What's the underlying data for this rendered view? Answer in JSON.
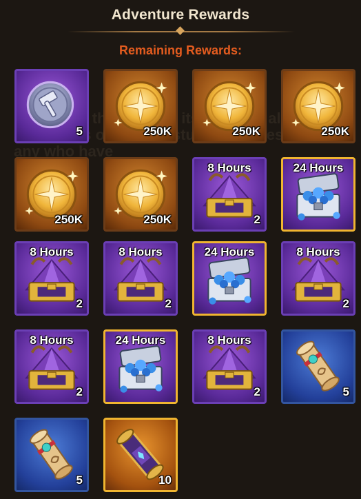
{
  "header": {
    "title": "Adventure Rewards",
    "subtitle": "Remaining Rewards:"
  },
  "rewards": [
    {
      "icon": "hammer-coin-icon",
      "style": "purple",
      "hours": "",
      "qty": "5"
    },
    {
      "icon": "gold-coin-icon",
      "style": "orange",
      "hours": "",
      "qty": "250K"
    },
    {
      "icon": "gold-coin-icon",
      "style": "orange",
      "hours": "",
      "qty": "250K"
    },
    {
      "icon": "gold-coin-icon",
      "style": "orange",
      "hours": "",
      "qty": "250K"
    },
    {
      "icon": "gold-coin-icon",
      "style": "orange",
      "hours": "",
      "qty": "250K"
    },
    {
      "icon": "gold-coin-icon",
      "style": "orange",
      "hours": "",
      "qty": "250K"
    },
    {
      "icon": "purple-chest-icon",
      "style": "purple",
      "hours": "8 Hours",
      "qty": "2"
    },
    {
      "icon": "blue-gem-chest-icon",
      "style": "gold",
      "hours": "24 Hours",
      "qty": ""
    },
    {
      "icon": "purple-chest-icon",
      "style": "purple",
      "hours": "8 Hours",
      "qty": "2"
    },
    {
      "icon": "purple-chest-icon",
      "style": "purple",
      "hours": "8 Hours",
      "qty": "2"
    },
    {
      "icon": "blue-gem-chest-icon",
      "style": "gold",
      "hours": "24 Hours",
      "qty": ""
    },
    {
      "icon": "purple-chest-icon",
      "style": "purple",
      "hours": "8 Hours",
      "qty": "2"
    },
    {
      "icon": "purple-chest-icon",
      "style": "purple",
      "hours": "8 Hours",
      "qty": "2"
    },
    {
      "icon": "blue-gem-chest-icon",
      "style": "gold",
      "hours": "24 Hours",
      "qty": ""
    },
    {
      "icon": "purple-chest-icon",
      "style": "purple",
      "hours": "8 Hours",
      "qty": "2"
    },
    {
      "icon": "scroll-icon",
      "style": "blue",
      "hours": "",
      "qty": "5"
    },
    {
      "icon": "scroll-icon",
      "style": "blue",
      "hours": "",
      "qty": "5"
    },
    {
      "icon": "magic-scroll-icon",
      "style": "goldorange",
      "hours": "",
      "qty": "10"
    }
  ],
  "background_text": "landscape that despite its elevated altitude ... Shrill cries of birds ... stunted copses of ... off any who have"
}
